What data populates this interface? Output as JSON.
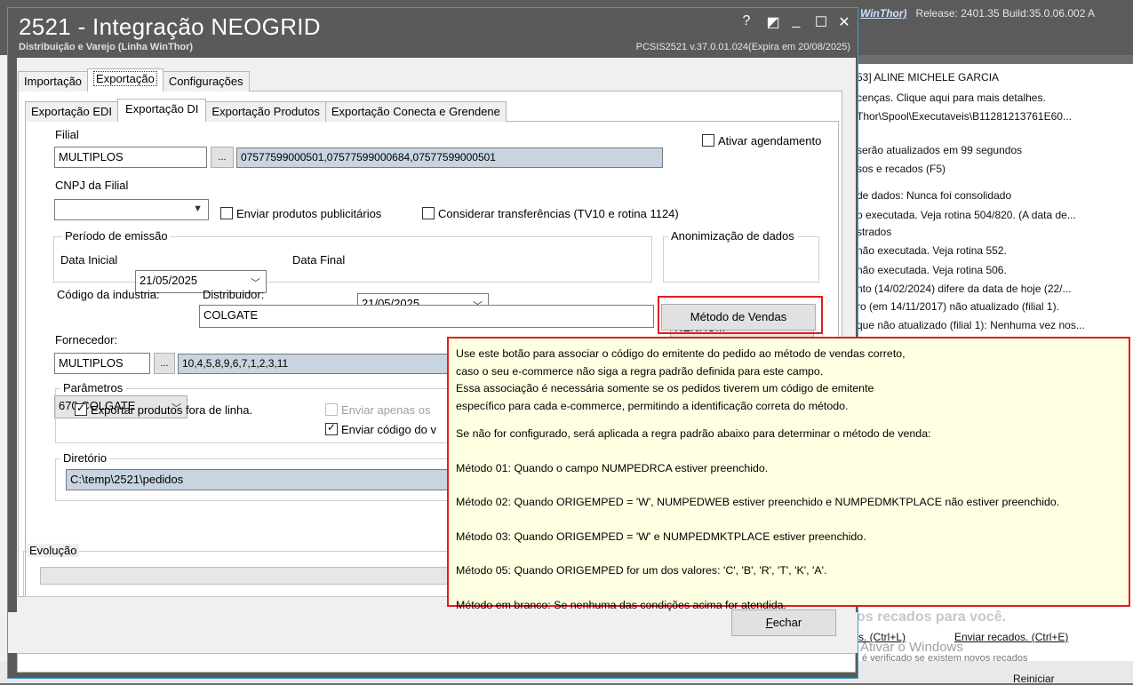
{
  "background": {
    "release_link": "WinThor)",
    "release_text": "Release: 2401.35 Build:35.0.06.002 A",
    "user_line": "53] ALINE MICHELE GARCIA",
    "lines": [
      "cenças. Clique aqui para mais detalhes.",
      "Thor\\Spool\\Executaveis\\B11281213761E60...",
      "serão atualizados em 99 segundos",
      "sos e recados (F5)",
      "de dados: Nunca foi consolidado",
      "o executada. Veja rotina 504/820. (A data de...",
      "strados",
      "não executada. Veja rotina 552.",
      "não executada. Veja rotina 506.",
      "nto (14/02/2024) difere da data de hoje (22/...",
      "ro (em 14/11/2017) não atualizado (filial 1).",
      "que não atualizado (filial 1): Nenhuma vez nos..."
    ],
    "recados_title": "os recados para você.",
    "link_left": "s. (Ctrl+L)",
    "link_right": "Enviar recados. (Ctrl+E)",
    "watermark": "Ativar o Windows",
    "watermark_sub": "é verificado se existem novos recados",
    "reiniciar": "Reiniciar"
  },
  "window": {
    "title": "2521 - Integração NEOGRID",
    "subtitle": "Distribuição e Varejo (Linha WinThor)",
    "version": "PCSIS2521  v.37.0.01.024(Expira em 20/08/2025)",
    "controls": [
      "?",
      "◩",
      "_",
      "☐",
      "✕"
    ]
  },
  "tabs_main": [
    "Importação",
    "Exportação",
    "Configurações"
  ],
  "tabs_sub": [
    "Exportação EDI",
    "Exportação DI",
    "Exportação Produtos",
    "Exportação Conecta e Grendene"
  ],
  "form": {
    "filial_label": "Filial",
    "filial_value": "MULTIPLOS",
    "filial_btn": "...",
    "filial_list": "07577599000501,07577599000684,07577599000501",
    "ativar_agendamento": "Ativar agendamento",
    "cnpj_label": "CNPJ da Filial",
    "enviar_publicitarios": "Enviar produtos publicitários",
    "considerar_transferencias": "Considerar transferências (TV10 e rotina 1124)",
    "periodo_label": "Período de emissão",
    "data_inicial_label": "Data Inicial",
    "data_inicial": "21/05/2025",
    "data_final_label": "Data Final",
    "data_final": "21/05/2025",
    "anonimizacao_label": "Anonimização de dados",
    "anonimizacao_value": "NENHUM",
    "codigo_industria_label": "Código da industria:",
    "codigo_industria_value": "670 COLGATE",
    "distribuidor_label": "Distribuidor:",
    "distribuidor_value": "COLGATE",
    "metodo_vendas_btn": "Método de Vendas",
    "fornecedor_label": "Fornecedor:",
    "fornecedor_value": "MULTIPLOS",
    "fornecedor_btn": "...",
    "fornecedor_list": "10,4,5,8,9,6,7,1,2,3,11",
    "parametros_label": "Parâmetros",
    "exportar_fora_linha": "Exportar produtos fora de linha.",
    "enviar_apenas": "Enviar apenas os",
    "enviar_codigo": "Enviar código do v",
    "diretorio_label": "Diretório",
    "diretorio_value": "C:\\temp\\2521\\pedidos",
    "evolucao_label": "Evolução"
  },
  "tooltip": {
    "lines": [
      "Use este botão para associar o código do emitente do pedido ao método de vendas correto,",
      "caso o seu e-commerce não siga a regra padrão definida para este campo.",
      "Essa associação é necessária somente se os pedidos tiverem um código de emitente",
      "específico para cada e-commerce, permitindo a identificação correta do método.",
      "",
      "Se não for configurado, será aplicada a regra padrão abaixo para determinar o método de venda:",
      "",
      "Método 01: Quando o campo NUMPEDRCA estiver preenchido.",
      "",
      "Método 02: Quando ORIGEMPED = 'W', NUMPEDWEB estiver preenchido e NUMPEDMKTPLACE não estiver preenchido.",
      "",
      "Método 03: Quando ORIGEMPED = 'W' e NUMPEDMKTPLACE estiver preenchido.",
      "",
      "Método 05: Quando ORIGEMPED for um dos valores: 'C', 'B', 'R', 'T', 'K', 'A'.",
      "",
      "Método em branco: Se nenhuma das condições acima for atendida."
    ]
  },
  "fechar_btn": {
    "underlined": "F",
    "rest": "echar"
  },
  "colors": {
    "highlight": "#e01d1d",
    "tooltip_bg": "#ffffe1",
    "titlebar": "#5a5a5a"
  }
}
